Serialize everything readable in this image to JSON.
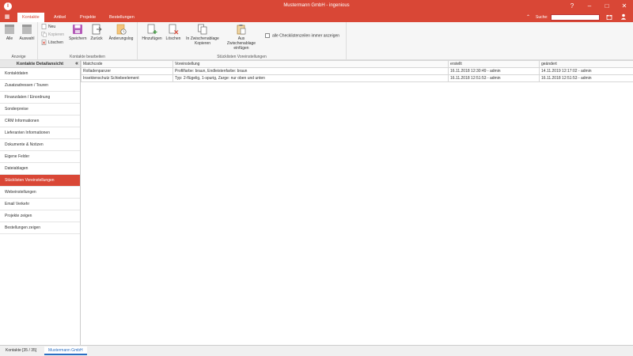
{
  "window": {
    "title": "Mustermann GmbH - ingenious",
    "controls": {
      "help": "?",
      "minimize": "–",
      "maximize": "□",
      "close": "✕"
    }
  },
  "ribbon_tabs": {
    "menu_icon": "grid-icon",
    "items": [
      "Kontakte",
      "Artikel",
      "Projekte",
      "Bestellungen"
    ],
    "active": "Kontakte",
    "search_label": "Suche:",
    "search_placeholder": ""
  },
  "ribbon": {
    "groups": [
      {
        "label": "Anzeige",
        "buttons": [
          "Alle",
          "Auswahl"
        ]
      },
      {
        "label": "Kontakte bearbeiten",
        "small_buttons": [
          "Neu",
          "Kopieren",
          "Löschen"
        ],
        "buttons": [
          "Speichern",
          "Zurück",
          "Änderungslog"
        ]
      },
      {
        "label": "Stücklisten Voreinstellungen",
        "buttons": [
          "Hinzufügen",
          "Löschen",
          "In Zwischenablage Kopieren",
          "Aus Zwischenablage einfügen"
        ],
        "checkbox": "alle Checklistenzeilen immer anzeigen"
      }
    ]
  },
  "sidebar": {
    "title": "Kontakte Detailansicht",
    "items": [
      "Kontaktdaten",
      "Zusatzadressen / Touren",
      "Finanzdaten / Einordnung",
      "Sonderpreise",
      "CRM Informationen",
      "Lieferanten Informationen",
      "Dokumente & Notizen",
      "Eigene Felder",
      "Dateiablagen",
      "Stücklisten Voreinstellungen",
      "Webeinstellungen",
      "Email Verkehr",
      "Projekte zeigen",
      "Bestellungen zeigen"
    ],
    "active": "Stücklisten Voreinstellungen"
  },
  "grid": {
    "columns": [
      "Matchcode",
      "Voreinstellung",
      "erstellt",
      "geändert"
    ],
    "rows": [
      [
        "Rolladenpanzer",
        "Profilfarbe: braun, Endleistenfarbe: braun",
        "16.11.2018 12:30:49 - admin",
        "14.11.2019 12:17:02 - admin"
      ],
      [
        "Insektenschutz Schiebeelement",
        "Typ: 2-flügelig, 1-spurig, Zarge: nur oben und unten",
        "16.11.2018 12:51:53 - admin",
        "16.11.2018 12:51:53 - admin"
      ]
    ]
  },
  "statusbar": {
    "tabs": [
      "Kontakte [35 / 35]",
      "Mustermann GmbH"
    ],
    "active": "Mustermann GmbH"
  },
  "colors": {
    "accent": "#d94736",
    "active_status_tab": "#2b6fc2"
  }
}
